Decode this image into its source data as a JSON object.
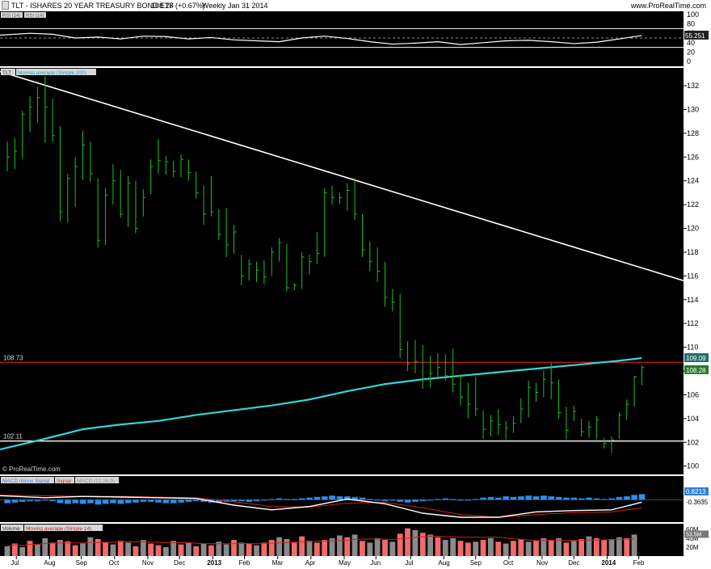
{
  "header": {
    "title": "TLT - ISHARES 20 YEAR TREASURY BOND ETF",
    "price": "108.28 (+0.67%)",
    "period": "Weekly",
    "date": "Jan 31 2014",
    "site": "www.ProRealTime.com"
  },
  "colors": {
    "background": "#000000",
    "bar_green": "#1fbf1f",
    "ma_cyan": "#33d6d6",
    "resistance_red": "#ff2020",
    "trendline": "#ffffff",
    "macd_blue": "#2f8fe8",
    "volume_bar": "#8a8a8a",
    "volume_up": "#f26a6a",
    "volume_ma": "#cc2222"
  },
  "rsi_panel": {
    "label_a": "RSI (14)",
    "label_b": "RSI (14)",
    "value_label": "55.251",
    "ticks": [
      "100",
      "80",
      "60",
      "40",
      "20",
      "0"
    ],
    "levels": [
      30,
      70
    ]
  },
  "price_panel": {
    "label_price": "TLT",
    "label_ma": "Moving average (Simple 200)",
    "watermark": "© ProRealTime.com",
    "ticks": [
      "132",
      "130",
      "128",
      "126",
      "124",
      "122",
      "120",
      "118",
      "116",
      "114",
      "112",
      "110",
      "108",
      "106",
      "104",
      "102",
      "100"
    ],
    "resistance_label": "108.73",
    "support_label": "102.11",
    "ma_value_label": "109.09",
    "price_value_label": "108.28"
  },
  "macd_panel": {
    "label_hist": "MACD minus Signal",
    "label_signal": "Signal",
    "label_macd": "MACD (12,26,9)",
    "value_hist": "0.8213",
    "value_macd": "-0.3635"
  },
  "volume_panel": {
    "label_volume": "Volume",
    "label_ma": "Moving average (Simple 14)",
    "ticks": [
      "60M",
      "40M",
      "20M"
    ],
    "value_label": "53.5M"
  },
  "x_axis": {
    "labels": [
      "Jul",
      "Aug",
      "Sep",
      "Oct",
      "Nov",
      "Dec",
      "2013",
      "Feb",
      "Mar",
      "Apr",
      "May",
      "Jun",
      "Jul",
      "Aug",
      "Sep",
      "Oct",
      "Nov",
      "Dec",
      "2014",
      "Feb"
    ],
    "bold": [
      "2013",
      "2014"
    ]
  },
  "chart_data": {
    "type": "ohlc",
    "title": "TLT - ISHARES 20 YEAR TREASURY BOND ETF",
    "period": "Weekly",
    "y_range": [
      99.3,
      133.5
    ],
    "x_range": [
      0,
      82
    ],
    "month_label_positions": [
      1.2,
      5.6,
      9.8,
      14.2,
      18.6,
      22.8,
      27.2,
      31.4,
      35.8,
      40.2,
      44.6,
      48.8,
      53.4,
      57.8,
      62.0,
      66.4,
      70.8,
      75.0,
      79.4,
      83.6
    ],
    "bars": [
      {
        "h": 127.3,
        "l": 124.8,
        "c": 126.0
      },
      {
        "h": 127.6,
        "l": 125.0,
        "c": 126.5
      },
      {
        "h": 129.9,
        "l": 125.9,
        "c": 129.6
      },
      {
        "h": 131.1,
        "l": 128.1,
        "c": 130.2
      },
      {
        "h": 131.9,
        "l": 128.9,
        "c": 131.0
      },
      {
        "h": 132.8,
        "l": 127.2,
        "c": 130.2
      },
      {
        "h": 130.9,
        "l": 127.3,
        "c": 127.8
      },
      {
        "h": 128.6,
        "l": 120.6,
        "c": 121.4
      },
      {
        "h": 124.6,
        "l": 120.5,
        "c": 124.2
      },
      {
        "h": 126.0,
        "l": 121.8,
        "c": 125.2
      },
      {
        "h": 128.2,
        "l": 124.1,
        "c": 127.0
      },
      {
        "h": 127.3,
        "l": 123.9,
        "c": 124.6
      },
      {
        "h": 124.2,
        "l": 118.4,
        "c": 119.0
      },
      {
        "h": 123.4,
        "l": 118.6,
        "c": 122.8
      },
      {
        "h": 125.4,
        "l": 122.0,
        "c": 124.0
      },
      {
        "h": 124.9,
        "l": 120.9,
        "c": 121.2
      },
      {
        "h": 124.4,
        "l": 120.1,
        "c": 123.8
      },
      {
        "h": 124.0,
        "l": 119.6,
        "c": 120.0
      },
      {
        "h": 123.3,
        "l": 121.0,
        "c": 122.6
      },
      {
        "h": 125.8,
        "l": 122.9,
        "c": 125.2
      },
      {
        "h": 127.5,
        "l": 124.6,
        "c": 125.7
      },
      {
        "h": 126.1,
        "l": 124.5,
        "c": 125.6
      },
      {
        "h": 125.7,
        "l": 124.3,
        "c": 124.8
      },
      {
        "h": 126.2,
        "l": 124.3,
        "c": 125.8
      },
      {
        "h": 125.8,
        "l": 124.0,
        "c": 124.7
      },
      {
        "h": 124.8,
        "l": 122.5,
        "c": 123.0
      },
      {
        "h": 123.6,
        "l": 120.3,
        "c": 121.2
      },
      {
        "h": 124.4,
        "l": 121.0,
        "c": 121.4
      },
      {
        "h": 121.6,
        "l": 119.0,
        "c": 119.5
      },
      {
        "h": 121.7,
        "l": 117.6,
        "c": 118.6
      },
      {
        "h": 120.3,
        "l": 117.9,
        "c": 119.7
      },
      {
        "h": 117.8,
        "l": 115.2,
        "c": 116.0
      },
      {
        "h": 117.4,
        "l": 115.6,
        "c": 117.0
      },
      {
        "h": 117.2,
        "l": 115.5,
        "c": 116.5
      },
      {
        "h": 117.3,
        "l": 115.3,
        "c": 115.9
      },
      {
        "h": 118.4,
        "l": 116.0,
        "c": 118.0
      },
      {
        "h": 119.2,
        "l": 117.2,
        "c": 118.8
      },
      {
        "h": 118.7,
        "l": 114.7,
        "c": 115.0
      },
      {
        "h": 115.4,
        "l": 114.8,
        "c": 115.2
      },
      {
        "h": 118.0,
        "l": 114.9,
        "c": 117.6
      },
      {
        "h": 117.8,
        "l": 116.1,
        "c": 117.2
      },
      {
        "h": 119.7,
        "l": 117.0,
        "c": 117.9
      },
      {
        "h": 123.4,
        "l": 117.6,
        "c": 123.0
      },
      {
        "h": 123.6,
        "l": 122.0,
        "c": 122.6
      },
      {
        "h": 123.0,
        "l": 122.0,
        "c": 122.6
      },
      {
        "h": 123.8,
        "l": 121.5,
        "c": 123.2
      },
      {
        "h": 124.2,
        "l": 120.7,
        "c": 121.2
      },
      {
        "h": 121.2,
        "l": 117.6,
        "c": 118.2
      },
      {
        "h": 118.9,
        "l": 116.4,
        "c": 117.2
      },
      {
        "h": 118.4,
        "l": 115.5,
        "c": 116.4
      },
      {
        "h": 117.2,
        "l": 113.4,
        "c": 114.2
      },
      {
        "h": 114.9,
        "l": 113.0,
        "c": 113.8
      },
      {
        "h": 114.5,
        "l": 109.1,
        "c": 109.8
      },
      {
        "h": 110.5,
        "l": 108.0,
        "c": 108.6
      },
      {
        "h": 110.6,
        "l": 107.8,
        "c": 108.8
      },
      {
        "h": 110.2,
        "l": 106.5,
        "c": 107.3
      },
      {
        "h": 109.3,
        "l": 106.6,
        "c": 107.8
      },
      {
        "h": 109.5,
        "l": 107.4,
        "c": 108.3
      },
      {
        "h": 109.4,
        "l": 107.2,
        "c": 107.6
      },
      {
        "h": 109.9,
        "l": 106.2,
        "c": 106.9
      },
      {
        "h": 107.7,
        "l": 105.1,
        "c": 105.8
      },
      {
        "h": 107.0,
        "l": 104.0,
        "c": 105.2
      },
      {
        "h": 107.5,
        "l": 104.2,
        "c": 104.8
      },
      {
        "h": 104.7,
        "l": 102.3,
        "c": 103.1
      },
      {
        "h": 104.3,
        "l": 102.5,
        "c": 103.8
      },
      {
        "h": 104.8,
        "l": 102.6,
        "c": 103.5
      },
      {
        "h": 103.8,
        "l": 102.2,
        "c": 103.2
      },
      {
        "h": 104.2,
        "l": 102.8,
        "c": 103.6
      },
      {
        "h": 105.7,
        "l": 103.6,
        "c": 104.8
      },
      {
        "h": 107.2,
        "l": 104.1,
        "c": 106.6
      },
      {
        "h": 107.0,
        "l": 105.4,
        "c": 106.2
      },
      {
        "h": 108.0,
        "l": 105.8,
        "c": 107.3
      },
      {
        "h": 108.7,
        "l": 105.6,
        "c": 107.0
      },
      {
        "h": 107.3,
        "l": 104.0,
        "c": 104.5
      },
      {
        "h": 105.0,
        "l": 102.2,
        "c": 103.0
      },
      {
        "h": 105.1,
        "l": 103.8,
        "c": 104.6
      },
      {
        "h": 104.0,
        "l": 102.5,
        "c": 102.9
      },
      {
        "h": 103.8,
        "l": 102.4,
        "c": 103.3
      },
      {
        "h": 104.2,
        "l": 102.3,
        "c": 103.9
      },
      {
        "h": 102.4,
        "l": 101.5,
        "c": 101.9
      },
      {
        "h": 102.5,
        "l": 101.1,
        "c": 102.2
      },
      {
        "h": 104.5,
        "l": 102.3,
        "c": 104.3
      },
      {
        "h": 105.6,
        "l": 103.9,
        "c": 105.2
      },
      {
        "h": 107.6,
        "l": 105.0,
        "c": 107.5
      },
      {
        "h": 108.5,
        "l": 106.8,
        "c": 108.28
      }
    ],
    "moving_average_200": {
      "x": [
        0,
        5,
        10,
        15,
        20,
        25,
        30,
        35,
        40,
        45,
        50,
        55,
        60,
        65,
        70,
        75,
        80,
        84
      ],
      "y": [
        101.4,
        102.3,
        103.1,
        103.5,
        103.8,
        104.3,
        104.7,
        105.1,
        105.6,
        106.3,
        106.9,
        107.3,
        107.6,
        107.9,
        108.2,
        108.5,
        108.8,
        109.09
      ]
    },
    "trendline": {
      "x": [
        0,
        87.2
      ],
      "y": [
        133.2,
        115.6
      ]
    },
    "resistance": 108.73,
    "support": 102.11,
    "rsi": {
      "x": [
        0,
        3,
        6,
        9,
        12,
        15,
        18,
        21,
        24,
        27,
        30,
        33,
        36,
        39,
        42,
        45,
        48,
        51,
        54,
        57,
        60,
        63,
        66,
        69,
        72,
        75,
        78,
        81,
        84
      ],
      "y": [
        56,
        60,
        58,
        50,
        52,
        48,
        54,
        53,
        48,
        51,
        46,
        44,
        42,
        50,
        54,
        49,
        42,
        37,
        39,
        42,
        36,
        40,
        44,
        45,
        42,
        38,
        41,
        48,
        55.251
      ]
    },
    "macd": {
      "range": [
        -3.2,
        2.2
      ],
      "histogram": [
        -0.5,
        -0.4,
        -0.3,
        -0.2,
        -0.2,
        -0.1,
        -0.2,
        -0.5,
        -0.6,
        -0.5,
        -0.6,
        -0.5,
        -0.7,
        -0.6,
        -0.5,
        -0.6,
        -0.5,
        -0.4,
        -0.3,
        -0.3,
        -0.4,
        -0.5,
        -0.5,
        -0.4,
        -0.3,
        -0.2,
        -0.3,
        -0.4,
        -0.4,
        -0.3,
        -0.2,
        -0.2,
        -0.3,
        -0.2,
        -0.1,
        0.1,
        0.2,
        0.1,
        0.1,
        0.2,
        0.3,
        0.4,
        0.5,
        0.6,
        0.5,
        0.5,
        0.4,
        0.3,
        0.1,
        -0.1,
        -0.2,
        -0.1,
        -0.3,
        -0.4,
        -0.3,
        -0.2,
        0.0,
        0.1,
        0.2,
        0.1,
        -0.1,
        0.0,
        0.1,
        0.3,
        0.4,
        0.3,
        0.5,
        0.4,
        0.5,
        0.6,
        0.5,
        0.6,
        0.5,
        0.4,
        0.3,
        0.3,
        0.2,
        0.3,
        0.2,
        0.1,
        0.2,
        0.4,
        0.5,
        0.7,
        0.8213
      ],
      "macd_line_x": [
        0,
        5,
        10,
        15,
        20,
        25,
        30,
        35,
        40,
        45,
        50,
        55,
        60,
        65,
        70,
        75,
        80,
        84
      ],
      "macd_line_y": [
        0.6,
        0.3,
        0.5,
        0.4,
        0.3,
        0.2,
        -0.8,
        -1.5,
        -1.0,
        0.1,
        -0.6,
        -2.0,
        -2.6,
        -2.6,
        -1.8,
        -1.6,
        -1.5,
        -0.36
      ],
      "signal_x": [
        0,
        5,
        10,
        15,
        20,
        25,
        30,
        35,
        40,
        45,
        50,
        55,
        60,
        65,
        70,
        75,
        80,
        84
      ],
      "signal_y": [
        0.7,
        0.6,
        0.5,
        0.5,
        0.4,
        0.3,
        -0.3,
        -1.0,
        -1.1,
        -0.5,
        -0.4,
        -1.2,
        -2.2,
        -2.6,
        -2.2,
        -1.9,
        -1.8,
        -1.2
      ]
    },
    "volume": {
      "range": [
        0,
        65
      ],
      "up": [
        0,
        1,
        0,
        1,
        0,
        0,
        1,
        0,
        1,
        1,
        0,
        0,
        1,
        1,
        0,
        1,
        0,
        1,
        0,
        1,
        1,
        0,
        0,
        1,
        0,
        1,
        0,
        1,
        0,
        0,
        1,
        0,
        1,
        0,
        1,
        1,
        0,
        0,
        1,
        1,
        0,
        1,
        1,
        0,
        0,
        1,
        0,
        1,
        0,
        0,
        1,
        0,
        1,
        1,
        0,
        1,
        0,
        1,
        0,
        0,
        1,
        1,
        0,
        1,
        0,
        1,
        0,
        1,
        1,
        0,
        1,
        0,
        1,
        0,
        1,
        0,
        1,
        0,
        1,
        1,
        0,
        0,
        1,
        0
      ],
      "values": [
        22,
        28,
        20,
        34,
        26,
        40,
        30,
        36,
        33,
        24,
        28,
        42,
        38,
        30,
        26,
        34,
        30,
        22,
        36,
        28,
        24,
        20,
        34,
        26,
        30,
        22,
        28,
        24,
        32,
        26,
        36,
        30,
        28,
        24,
        30,
        36,
        42,
        38,
        30,
        44,
        34,
        30,
        36,
        40,
        46,
        42,
        48,
        34,
        30,
        40,
        36,
        32,
        50,
        62,
        58,
        52,
        48,
        42,
        36,
        40,
        34,
        30,
        32,
        36,
        40,
        32,
        28,
        34,
        38,
        32,
        34,
        40,
        36,
        40,
        30,
        34,
        38,
        44,
        40,
        36,
        38,
        42,
        40,
        48
      ]
    }
  }
}
